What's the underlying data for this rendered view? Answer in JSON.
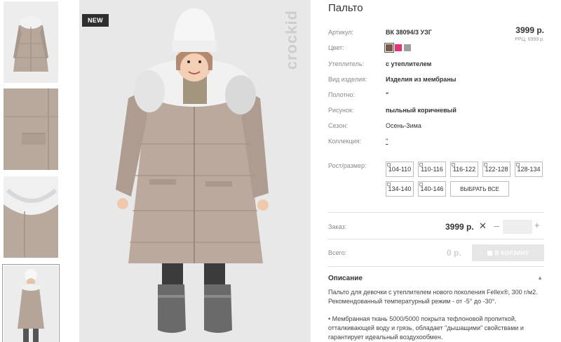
{
  "product": {
    "title": "Пальто",
    "price": "3999 р.",
    "rrp": "РРЦ: 6999 р."
  },
  "badge_new": "NEW",
  "brand_watermark": "crockid",
  "specs": [
    {
      "label": "Артикул:",
      "value": "ВК 38094/3 УЗГ"
    },
    {
      "label": "Цвет:",
      "value": ""
    },
    {
      "label": "Утеплитель:",
      "value": "с утеплителем"
    },
    {
      "label": "Вид изделия:",
      "value": "Изделия из мембраны"
    },
    {
      "label": "Полотно:",
      "value": "\""
    },
    {
      "label": "Рисунок:",
      "value": "пыльный коричневый"
    },
    {
      "label": "Сезон:",
      "value": "Осень-Зима"
    },
    {
      "label": "Коллекция:",
      "value": "\""
    }
  ],
  "colors": [
    {
      "name": "brown",
      "hex": "#7a5a44",
      "selected": true
    },
    {
      "name": "pink",
      "hex": "#e5337a",
      "selected": false
    },
    {
      "name": "grey",
      "hex": "#9e9e9e",
      "selected": false
    }
  ],
  "size_label": "Рост/размер:",
  "sizes": [
    "104-110",
    "110-116",
    "116-122",
    "122-128",
    "128-134",
    "134-140",
    "140-146"
  ],
  "select_all": "ВЫБРАТЬ ВСЕ",
  "order": {
    "label": "Заказ:",
    "price": "3999 р.",
    "remove_icon": "close-icon",
    "minus": "–",
    "plus": "+",
    "qty_value": ""
  },
  "total": {
    "label": "Всего:",
    "value": "0 р.",
    "cart_button": "В КОРЗИНУ"
  },
  "description": {
    "title": "Описание",
    "p1": "Пальто для девочки с утеплителем нового поколения Fellex®, 300 г/м2. Рекомендованный температурный режим - от -5° до -30°.",
    "p2": "• Мембранная ткань 5000/5000 покрыта тефлоновой пропиткой, отталкивающей воду и грязь, обладает \"дышащими\" свойствами и гарантирует идеальный воздухообмен."
  },
  "accent_colors": {
    "coat": "#b9a99c",
    "fur": "#eeeeee",
    "hat": "#f4f4f4"
  }
}
